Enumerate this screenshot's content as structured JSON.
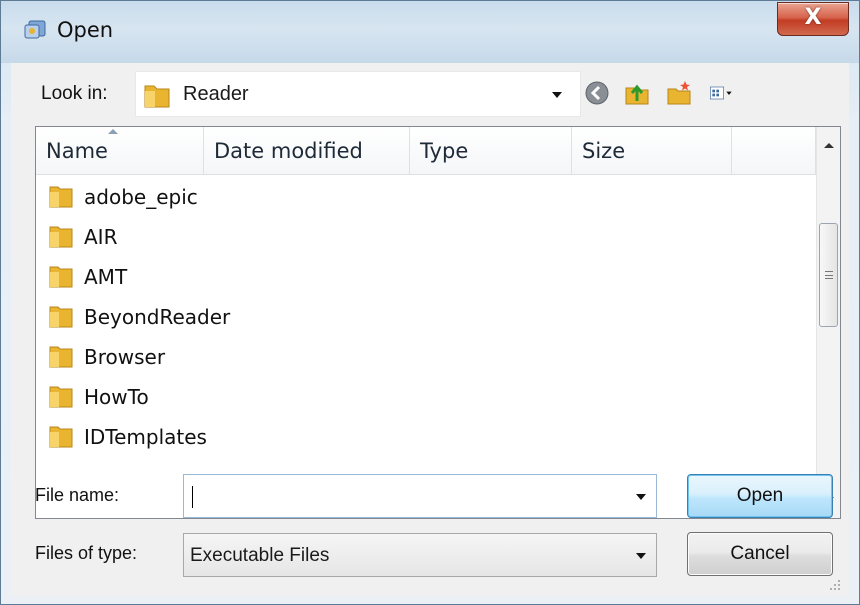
{
  "window": {
    "title": "Open",
    "close_label": "X"
  },
  "toolbar": {
    "lookin_label": "Look in:",
    "lookin_value": "Reader",
    "icons": [
      "back-icon",
      "up-folder-icon",
      "new-folder-icon",
      "views-menu-icon"
    ]
  },
  "filelist": {
    "columns": [
      "Name",
      "Date modified",
      "Type",
      "Size"
    ],
    "items": [
      "adobe_epic",
      "AIR",
      "AMT",
      "BeyondReader",
      "Browser",
      "HowTo",
      "IDTemplates"
    ]
  },
  "form": {
    "filename_label": "File name:",
    "filename_value": "",
    "filetype_label": "Files of type:",
    "filetype_value": "Executable Files"
  },
  "buttons": {
    "open_label": "Open",
    "cancel_label": "Cancel"
  },
  "colors": {
    "folder": "#e9b530",
    "close_red": "#c23d24",
    "accent_blue": "#3c7fb1"
  }
}
